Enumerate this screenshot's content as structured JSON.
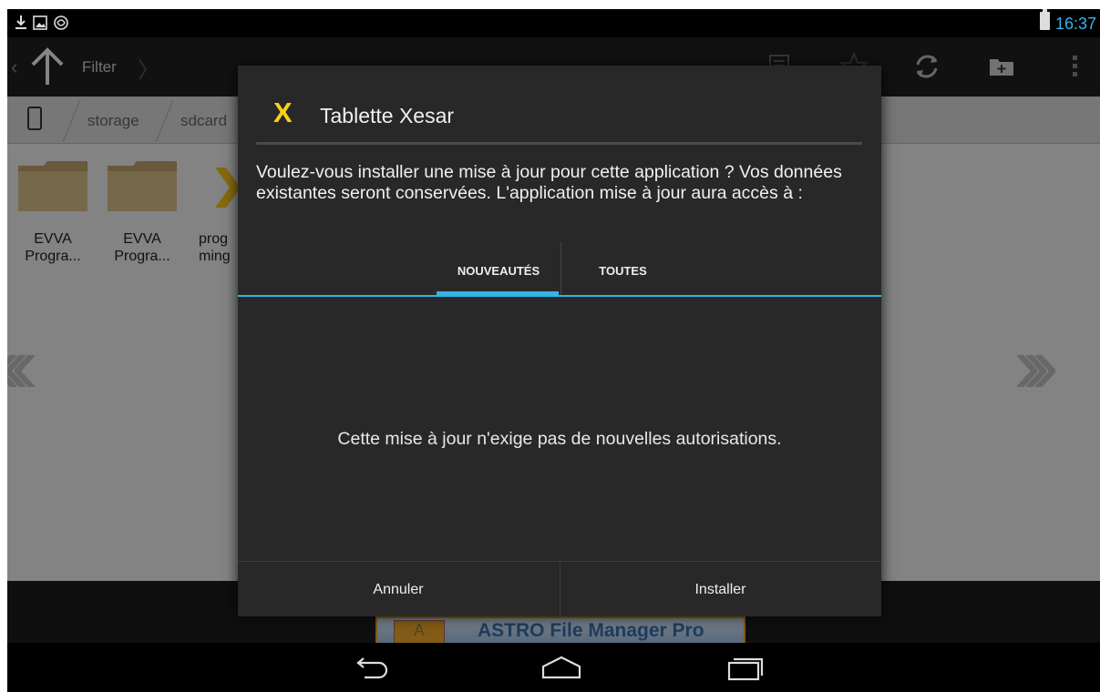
{
  "status_bar": {
    "clock": "16:37",
    "icons": [
      "download-icon",
      "image-icon",
      "sync-icon",
      "battery-icon"
    ]
  },
  "action_bar": {
    "filter_label": "Filter",
    "icons": [
      "up-arrow-icon",
      "list-view-icon",
      "star-icon",
      "refresh-icon",
      "new-folder-icon",
      "overflow-menu-icon"
    ]
  },
  "path_bar": {
    "crumbs": [
      "storage",
      "sdcard"
    ]
  },
  "files": [
    {
      "name_line1": "EVVA",
      "name_line2": "Progra..."
    },
    {
      "name_line1": "EVVA",
      "name_line2": "Progra..."
    },
    {
      "name_line1": "prog",
      "name_line2": "ming"
    }
  ],
  "ad": {
    "text": "ASTRO File Manager Pro"
  },
  "dialog": {
    "app_icon_glyph": "X",
    "title": "Tablette Xesar",
    "message": "Voulez-vous installer une mise à jour pour cette application ? Vos données existantes seront conservées. L'application mise à jour aura accès à :",
    "tabs": [
      "NOUVEAUTÉS",
      "TOUTES"
    ],
    "selected_tab": "NOUVEAUTÉS",
    "body_text": "Cette mise à jour n'exige pas de nouvelles autorisations.",
    "cancel_label": "Annuler",
    "install_label": "Installer"
  },
  "colors": {
    "accent": "#33b5e5",
    "dialog_bg": "#282828",
    "app_icon": "#f7d20e"
  },
  "nav_bar": {
    "icons": [
      "back-icon",
      "home-icon",
      "recents-icon"
    ]
  }
}
